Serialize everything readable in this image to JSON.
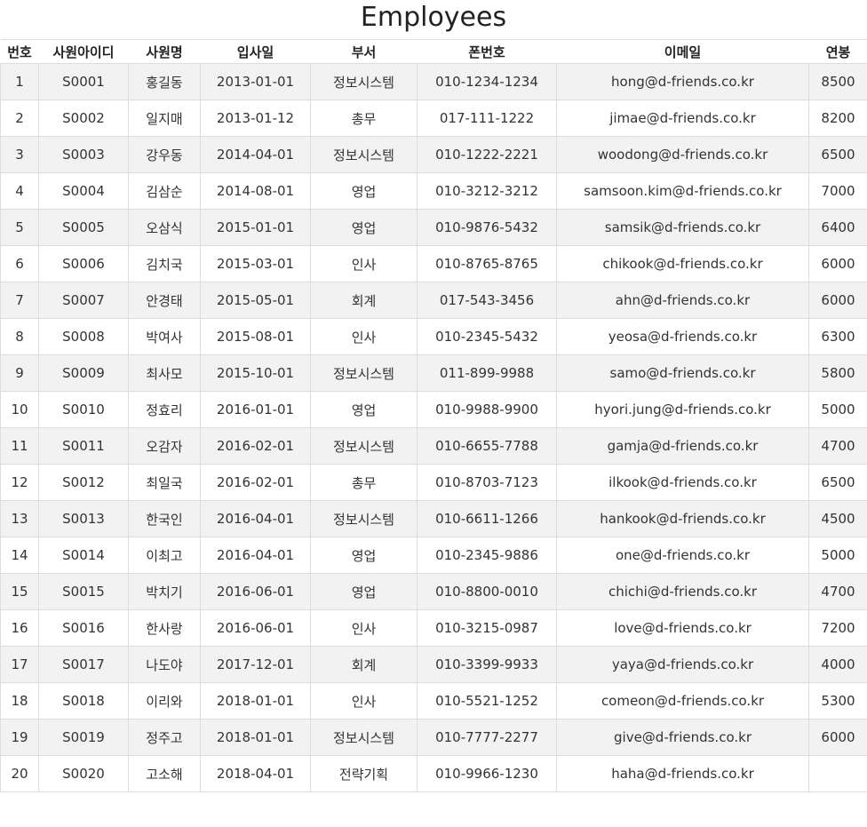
{
  "title": "Employees",
  "columns": [
    "번호",
    "사원아이디",
    "사원명",
    "입사일",
    "부서",
    "폰번호",
    "이메일",
    "연봉"
  ],
  "rows": [
    [
      "1",
      "S0001",
      "홍길동",
      "2013-01-01",
      "정보시스템",
      "010-1234-1234",
      "hong@d-friends.co.kr",
      "8500"
    ],
    [
      "2",
      "S0002",
      "일지매",
      "2013-01-12",
      "총무",
      "017-111-1222",
      "jimae@d-friends.co.kr",
      "8200"
    ],
    [
      "3",
      "S0003",
      "강우동",
      "2014-04-01",
      "정보시스템",
      "010-1222-2221",
      "woodong@d-friends.co.kr",
      "6500"
    ],
    [
      "4",
      "S0004",
      "김삼순",
      "2014-08-01",
      "영업",
      "010-3212-3212",
      "samsoon.kim@d-friends.co.kr",
      "7000"
    ],
    [
      "5",
      "S0005",
      "오삼식",
      "2015-01-01",
      "영업",
      "010-9876-5432",
      "samsik@d-friends.co.kr",
      "6400"
    ],
    [
      "6",
      "S0006",
      "김치국",
      "2015-03-01",
      "인사",
      "010-8765-8765",
      "chikook@d-friends.co.kr",
      "6000"
    ],
    [
      "7",
      "S0007",
      "안경태",
      "2015-05-01",
      "회계",
      "017-543-3456",
      "ahn@d-friends.co.kr",
      "6000"
    ],
    [
      "8",
      "S0008",
      "박여사",
      "2015-08-01",
      "인사",
      "010-2345-5432",
      "yeosa@d-friends.co.kr",
      "6300"
    ],
    [
      "9",
      "S0009",
      "최사모",
      "2015-10-01",
      "정보시스템",
      "011-899-9988",
      "samo@d-friends.co.kr",
      "5800"
    ],
    [
      "10",
      "S0010",
      "정효리",
      "2016-01-01",
      "영업",
      "010-9988-9900",
      "hyori.jung@d-friends.co.kr",
      "5000"
    ],
    [
      "11",
      "S0011",
      "오감자",
      "2016-02-01",
      "정보시스템",
      "010-6655-7788",
      "gamja@d-friends.co.kr",
      "4700"
    ],
    [
      "12",
      "S0012",
      "최일국",
      "2016-02-01",
      "총무",
      "010-8703-7123",
      "ilkook@d-friends.co.kr",
      "6500"
    ],
    [
      "13",
      "S0013",
      "한국인",
      "2016-04-01",
      "정보시스템",
      "010-6611-1266",
      "hankook@d-friends.co.kr",
      "4500"
    ],
    [
      "14",
      "S0014",
      "이최고",
      "2016-04-01",
      "영업",
      "010-2345-9886",
      "one@d-friends.co.kr",
      "5000"
    ],
    [
      "15",
      "S0015",
      "박치기",
      "2016-06-01",
      "영업",
      "010-8800-0010",
      "chichi@d-friends.co.kr",
      "4700"
    ],
    [
      "16",
      "S0016",
      "한사랑",
      "2016-06-01",
      "인사",
      "010-3215-0987",
      "love@d-friends.co.kr",
      "7200"
    ],
    [
      "17",
      "S0017",
      "나도야",
      "2017-12-01",
      "회계",
      "010-3399-9933",
      "yaya@d-friends.co.kr",
      "4000"
    ],
    [
      "18",
      "S0018",
      "이리와",
      "2018-01-01",
      "인사",
      "010-5521-1252",
      "comeon@d-friends.co.kr",
      "5300"
    ],
    [
      "19",
      "S0019",
      "정주고",
      "2018-01-01",
      "정보시스템",
      "010-7777-2277",
      "give@d-friends.co.kr",
      "6000"
    ],
    [
      "20",
      "S0020",
      "고소해",
      "2018-04-01",
      "전략기획",
      "010-9966-1230",
      "haha@d-friends.co.kr",
      ""
    ]
  ]
}
